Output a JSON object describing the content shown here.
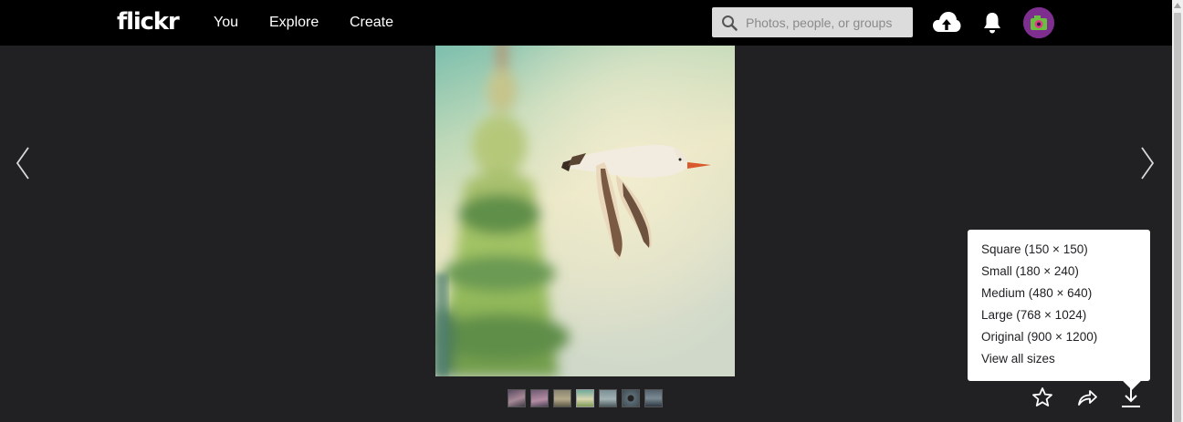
{
  "header": {
    "logo": "flickr",
    "nav": {
      "you": "You",
      "explore": "Explore",
      "create": "Create"
    },
    "search_placeholder": "Photos, people, or groups",
    "icons": [
      "search-icon",
      "upload-cloud-icon",
      "notification-bell-icon",
      "avatar"
    ]
  },
  "viewer": {
    "prev_icon": "chevron-left-icon",
    "next_icon": "chevron-right-icon",
    "thumbnails": 7,
    "active_thumbnail": 4
  },
  "download_menu": {
    "items": [
      "Square (150 × 150)",
      "Small (180 × 240)",
      "Medium (480 × 640)",
      "Large (768 × 1024)",
      "Original (900 × 1200)",
      "View all sizes"
    ]
  },
  "actions": [
    "star-icon",
    "share-icon",
    "download-icon"
  ],
  "colors": {
    "background": "#212124",
    "header": "#000000",
    "accent_avatar": "#7d2e8f"
  }
}
